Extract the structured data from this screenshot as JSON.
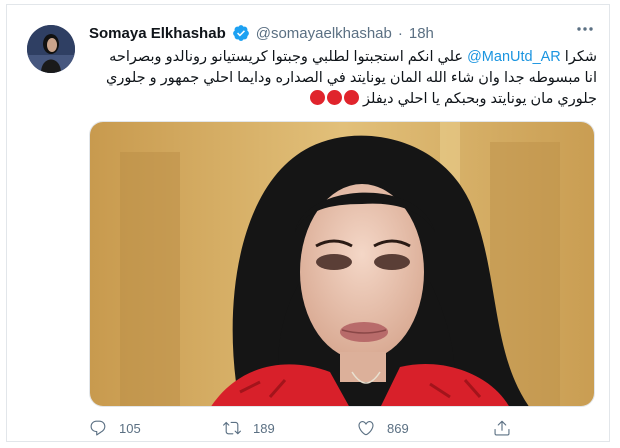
{
  "tweet": {
    "author": {
      "display_name": "Somaya Elkhashab",
      "handle": "@somayaelkhashab",
      "verified": true
    },
    "separator": "·",
    "time": "18h",
    "text_lines": [
      {
        "prefix": "شكرا ",
        "mention": "@ManUtd_AR",
        "suffix": " علي انكم استجبتوا لطلبي وجبتوا كريستيانو رونالدو وبصراحه"
      },
      {
        "prefix": "انا مبسوطه جدا وان شاء الله المان يونايتد في الصداره ودايما احلي جمهور و جلوري",
        "mention": "",
        "suffix": ""
      },
      {
        "prefix": "جلوري مان يونايتد وبحبكم يا احلي ديفلز",
        "mention": "",
        "suffix": ""
      }
    ],
    "emoji": "red-circle x3",
    "stats": {
      "replies": "105",
      "retweets": "189",
      "likes": "869"
    }
  },
  "icons": {
    "reply": "speech-bubble-icon",
    "retweet": "retweet-arrows-icon",
    "like": "heart-icon",
    "share": "share-upload-icon",
    "verified": "verified-badge-icon",
    "more": "more-dots-icon"
  },
  "colors": {
    "verified_blue": "#1da1f2",
    "mention_blue": "#1b95e0",
    "muted_gray": "#5b7083",
    "emoji_red": "#e0242c"
  }
}
